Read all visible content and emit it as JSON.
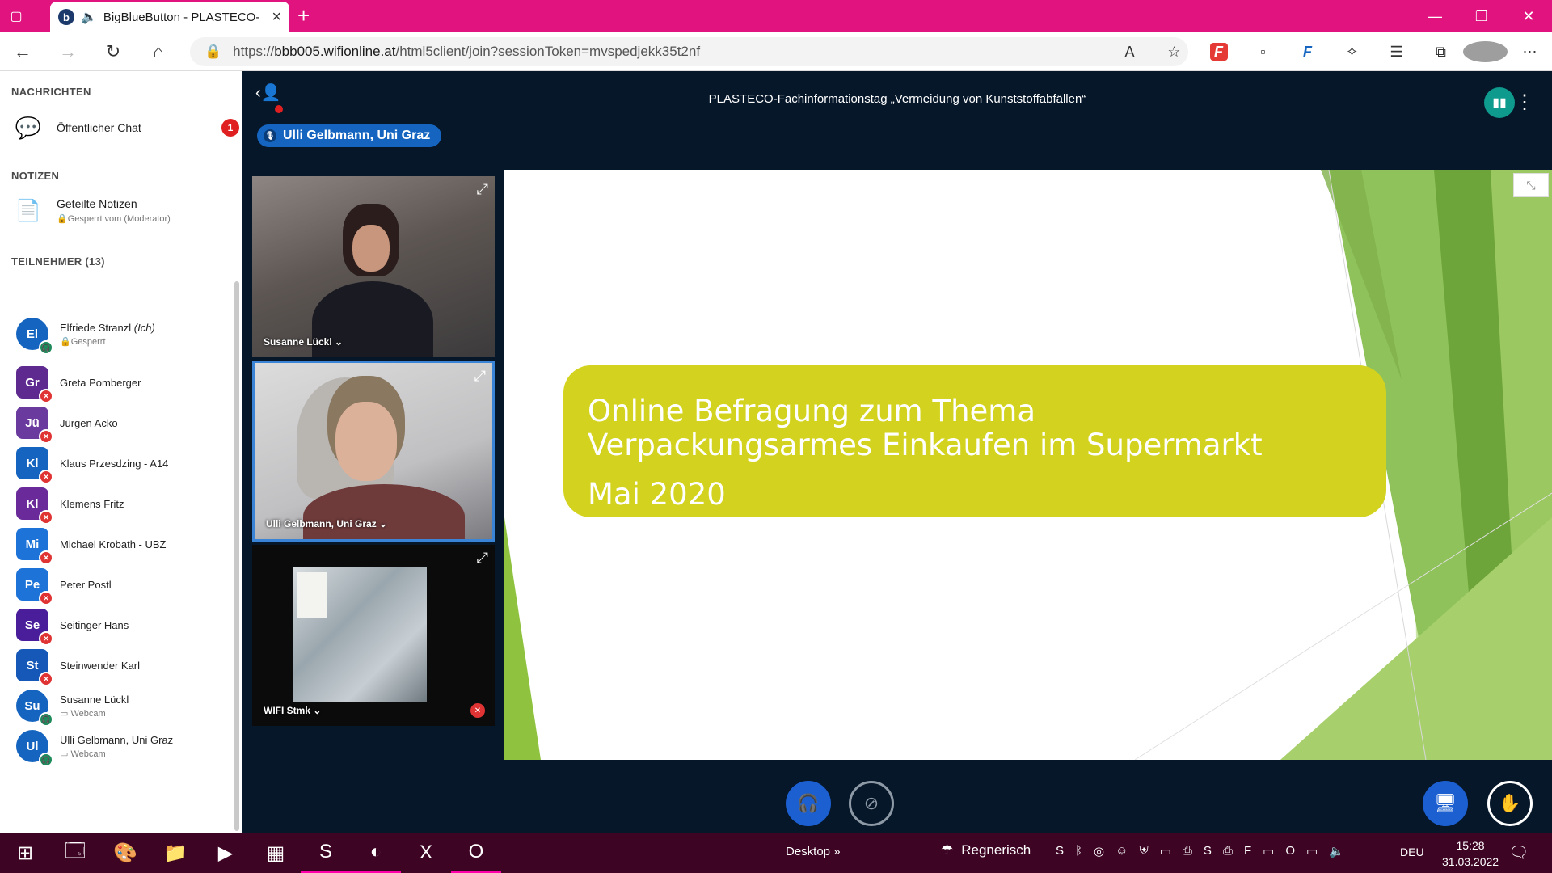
{
  "browser": {
    "tab_title": "BigBlueButton - PLASTECO-",
    "tab_favicon": "b",
    "new_tab": "+",
    "url_scheme": "https://",
    "url_host": "bbb005.wifionline.at",
    "url_path": "/html5client/join?sessionToken=mvspedjekk35t2nf",
    "ext_f": "F"
  },
  "sidebar": {
    "messages_title": "NACHRICHTEN",
    "public_chat": "Öffentlicher Chat",
    "unread": "1",
    "notes_title": "NOTIZEN",
    "shared_notes": "Geteilte Notizen",
    "notes_locked": "Gesperrt vom (Moderator)",
    "participants_title": "TEILNEHMER (13)",
    "users": [
      {
        "initials": "El",
        "name": "Elfriede Stranzl",
        "me": "(Ich)",
        "sub": "Gesperrt",
        "color": "#1565c0"
      },
      {
        "initials": "Gr",
        "name": "Greta Pomberger",
        "sub": "",
        "color": "#5e2a8f"
      },
      {
        "initials": "Jü",
        "name": "Jürgen Acko",
        "sub": "",
        "color": "#6a3a9f"
      },
      {
        "initials": "Kl",
        "name": "Klaus Przesdzing - A14",
        "sub": "",
        "color": "#1565c0"
      },
      {
        "initials": "Kl",
        "name": "Klemens Fritz",
        "sub": "",
        "color": "#6a2a9a"
      },
      {
        "initials": "Mi",
        "name": "Michael Krobath - UBZ",
        "sub": "",
        "color": "#1e73d8"
      },
      {
        "initials": "Pe",
        "name": "Peter Postl",
        "sub": "",
        "color": "#1e73d8"
      },
      {
        "initials": "Se",
        "name": "Seitinger Hans",
        "sub": "",
        "color": "#4a1e9a"
      },
      {
        "initials": "St",
        "name": "Steinwender Karl",
        "sub": "",
        "color": "#1558b8"
      },
      {
        "initials": "Su",
        "name": "Susanne Lückl",
        "sub": "Webcam",
        "color": "#1565c0"
      },
      {
        "initials": "Ul",
        "name": "Ulli Gelbmann, Uni Graz",
        "sub": "Webcam",
        "color": "#1565c0"
      }
    ]
  },
  "meeting": {
    "title": "PLASTECO-Fachinformationstag „Vermeidung von Kunststoffabfällen“",
    "talker": "Ulli Gelbmann, Uni Graz"
  },
  "videos": [
    {
      "name": "Susanne Lückl"
    },
    {
      "name": "Ulli Gelbmann, Uni Graz"
    },
    {
      "name": "WIFI Stmk"
    }
  ],
  "slide": {
    "line1": "Online Befragung zum Thema",
    "line2": "Verpackungsarmes Einkaufen im Supermarkt",
    "line3": "Mai 2020"
  },
  "taskbar": {
    "desktop": "Desktop",
    "weather": "Regnerisch",
    "lang": "DEU",
    "time": "15:28",
    "date": "31.03.2022"
  }
}
